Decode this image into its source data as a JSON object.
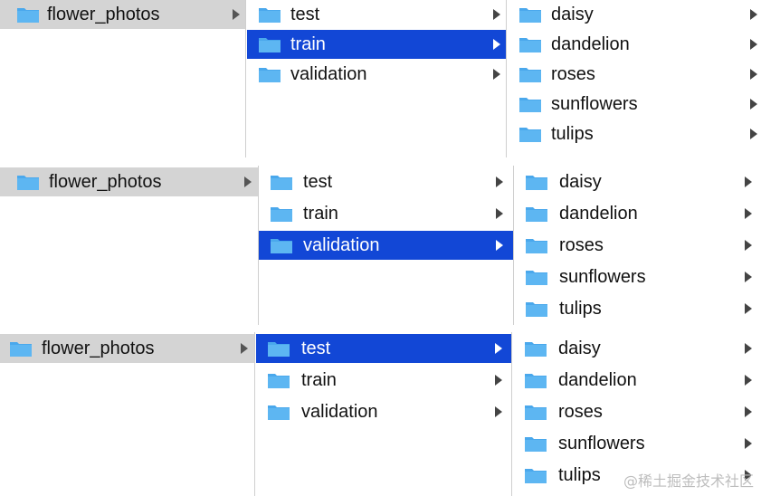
{
  "panels": [
    {
      "root": {
        "label": "flower_photos"
      },
      "subfolders": [
        {
          "label": "test",
          "selected": false
        },
        {
          "label": "train",
          "selected": true
        },
        {
          "label": "validation",
          "selected": false
        }
      ],
      "classes": [
        "daisy",
        "dandelion",
        "roses",
        "sunflowers",
        "tulips"
      ]
    },
    {
      "root": {
        "label": "flower_photos"
      },
      "subfolders": [
        {
          "label": "test",
          "selected": false
        },
        {
          "label": "train",
          "selected": false
        },
        {
          "label": "validation",
          "selected": true
        }
      ],
      "classes": [
        "daisy",
        "dandelion",
        "roses",
        "sunflowers",
        "tulips"
      ]
    },
    {
      "root": {
        "label": "flower_photos"
      },
      "subfolders": [
        {
          "label": "test",
          "selected": true
        },
        {
          "label": "train",
          "selected": false
        },
        {
          "label": "validation",
          "selected": false
        }
      ],
      "classes": [
        "daisy",
        "dandelion",
        "roses",
        "sunflowers",
        "tulips"
      ]
    }
  ],
  "watermark": "@稀土掘金技术社区",
  "colors": {
    "selection_blue": "#1247d6",
    "selection_grey": "#d4d4d4",
    "folder_blue": "#4aa8ec"
  },
  "icons": {
    "folder": "folder-icon",
    "chevron": "chevron-right-icon"
  }
}
